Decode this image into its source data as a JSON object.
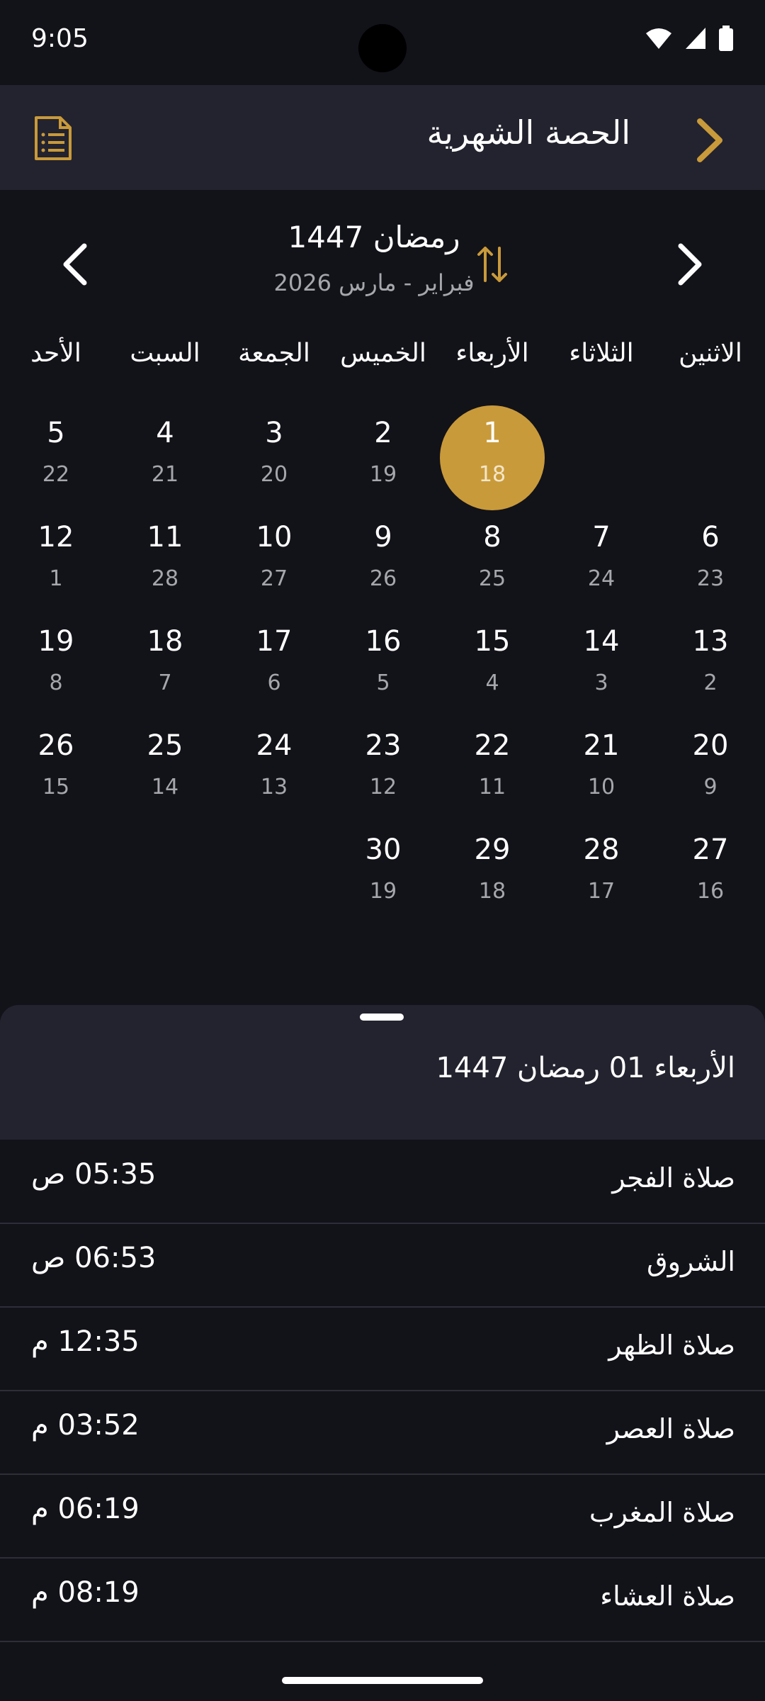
{
  "status": {
    "time": "9:05"
  },
  "app_bar": {
    "title": "الحصة الشهرية"
  },
  "month": {
    "hijri": "رمضان 1447",
    "gregorian": "فبراير - مارس 2026"
  },
  "weekdays": [
    "الاثنين",
    "الثلاثاء",
    "الأربعاء",
    "الخميس",
    "الجمعة",
    "السبت",
    "الأحد"
  ],
  "calendar": {
    "selected_day": "1",
    "weeks": [
      [
        null,
        null,
        {
          "h": "1",
          "g": "18"
        },
        {
          "h": "2",
          "g": "19"
        },
        {
          "h": "3",
          "g": "20"
        },
        {
          "h": "4",
          "g": "21"
        },
        {
          "h": "5",
          "g": "22"
        }
      ],
      [
        {
          "h": "6",
          "g": "23"
        },
        {
          "h": "7",
          "g": "24"
        },
        {
          "h": "8",
          "g": "25"
        },
        {
          "h": "9",
          "g": "26"
        },
        {
          "h": "10",
          "g": "27"
        },
        {
          "h": "11",
          "g": "28"
        },
        {
          "h": "12",
          "g": "1"
        }
      ],
      [
        {
          "h": "13",
          "g": "2"
        },
        {
          "h": "14",
          "g": "3"
        },
        {
          "h": "15",
          "g": "4"
        },
        {
          "h": "16",
          "g": "5"
        },
        {
          "h": "17",
          "g": "6"
        },
        {
          "h": "18",
          "g": "7"
        },
        {
          "h": "19",
          "g": "8"
        }
      ],
      [
        {
          "h": "20",
          "g": "9"
        },
        {
          "h": "21",
          "g": "10"
        },
        {
          "h": "22",
          "g": "11"
        },
        {
          "h": "23",
          "g": "12"
        },
        {
          "h": "24",
          "g": "13"
        },
        {
          "h": "25",
          "g": "14"
        },
        {
          "h": "26",
          "g": "15"
        }
      ],
      [
        {
          "h": "27",
          "g": "16"
        },
        {
          "h": "28",
          "g": "17"
        },
        {
          "h": "29",
          "g": "18"
        },
        {
          "h": "30",
          "g": "19"
        },
        null,
        null,
        null
      ]
    ]
  },
  "selected_date": "الأربعاء 01 رمضان 1447",
  "prayers": [
    {
      "name": "صلاة الفجر",
      "time": "05:35 ص"
    },
    {
      "name": "الشروق",
      "time": "06:53 ص"
    },
    {
      "name": "صلاة الظهر",
      "time": "12:35 م"
    },
    {
      "name": "صلاة العصر",
      "time": "03:52 م"
    },
    {
      "name": "صلاة المغرب",
      "time": "06:19 م"
    },
    {
      "name": "صلاة العشاء",
      "time": "08:19 م"
    }
  ],
  "colors": {
    "background": "#121219",
    "surface": "#23232f",
    "accent": "#c99a3a",
    "muted_text": "#a6a6ad"
  },
  "icons": {
    "back": "chevron-right-icon",
    "report": "document-list-icon",
    "prev": "chevron-left-icon",
    "next": "chevron-right-icon",
    "swap": "swap-vertical-icon"
  }
}
